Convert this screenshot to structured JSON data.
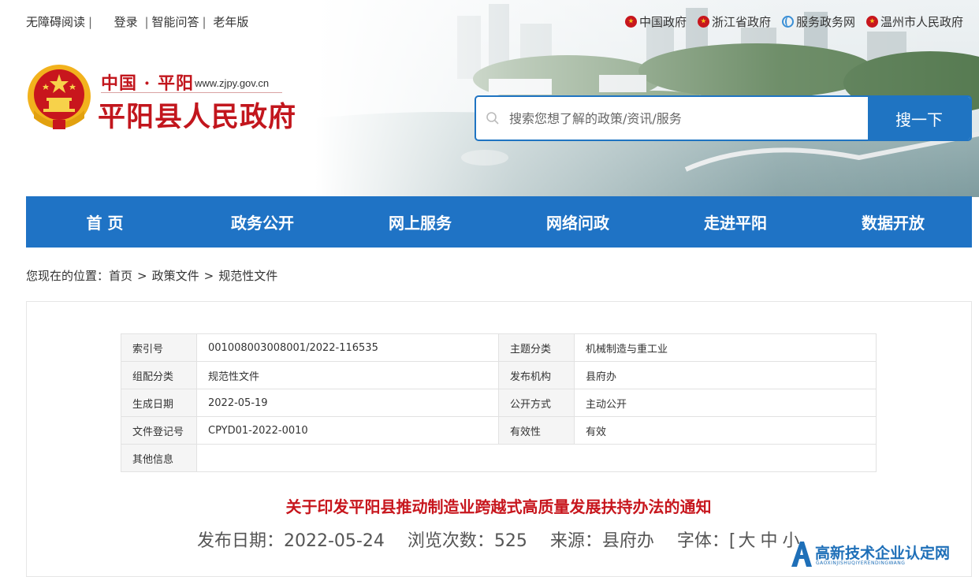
{
  "topbar": {
    "accessibility": "无障碍阅读",
    "login": "登录",
    "qa": "智能问答",
    "elder": "老年版"
  },
  "toplinks": [
    {
      "label": "中国政府",
      "icon": "emblem-icon"
    },
    {
      "label": "浙江省政府",
      "icon": "emblem-icon"
    },
    {
      "label": "服务政务网",
      "icon": "globe-icon"
    },
    {
      "label": "温州市人民政府",
      "icon": "emblem-icon"
    }
  ],
  "logo": {
    "small": "中国 · 平阳",
    "url": "www.zjpy.gov.cn",
    "big": "平阳县人民政府"
  },
  "search": {
    "placeholder": "搜索您想了解的政策/资讯/服务",
    "button": "搜一下"
  },
  "nav": [
    "首 页",
    "政务公开",
    "网上服务",
    "网络问政",
    "走进平阳",
    "数据开放"
  ],
  "breadcrumb": {
    "prefix": "您现在的位置：",
    "items": [
      "首页",
      "政策文件",
      "规范性文件"
    ]
  },
  "meta": {
    "index_label": "索引号",
    "index_value": "001008003008001/2022-116535",
    "topic_label": "主题分类",
    "topic_value": "机械制造与重工业",
    "group_label": "组配分类",
    "group_value": "规范性文件",
    "org_label": "发布机构",
    "org_value": "县府办",
    "date_label": "生成日期",
    "date_value": "2022-05-19",
    "open_label": "公开方式",
    "open_value": "主动公开",
    "reg_label": "文件登记号",
    "reg_value": "CPYD01-2022-0010",
    "valid_label": "有效性",
    "valid_value": "有效",
    "other_label": "其他信息",
    "other_value": ""
  },
  "document": {
    "title": "关于印发平阳县推动制造业跨越式高质量发展扶持办法的通知",
    "publish": "发布日期：2022-05-24",
    "views": "浏览次数：525",
    "source": "来源：县府办",
    "font_label": "字体：[",
    "font_large": "大",
    "font_medium": "中",
    "font_small": "小"
  },
  "watermark": {
    "text": "高新技术企业认定网",
    "sub": "GAOXINJISHUQIYERENDINGWANG"
  },
  "colors": {
    "brand_red": "#c2161d",
    "nav_blue": "#1f73c5",
    "search_blue": "#1f74c2"
  }
}
